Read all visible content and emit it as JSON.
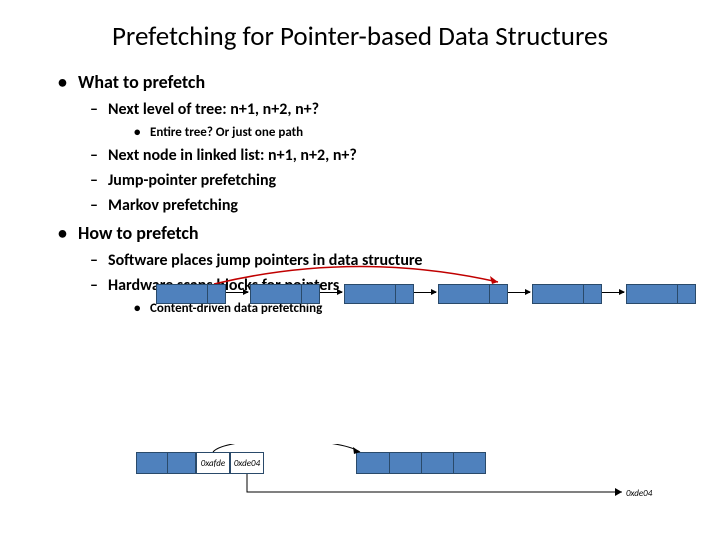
{
  "title": "Prefetching for Pointer-based Data Structures",
  "l1a": "What to prefetch",
  "l2a": "Next level of tree: n+1, n+2, n+?",
  "l3a": "Entire tree? Or just one path",
  "l2b": "Next node in linked list: n+1, n+2, n+?",
  "l2c": "Jump-pointer prefetching",
  "l2d": "Markov prefetching",
  "l1b": "How to prefetch",
  "l2e": "Software places jump pointers in data structure",
  "l2f": "Hardware scans blocks for pointers",
  "l3b": "Content-driven data prefetching",
  "mem_ptr1": "0xafde",
  "mem_ptr2": "0xde04",
  "mem_far": "0xde04"
}
